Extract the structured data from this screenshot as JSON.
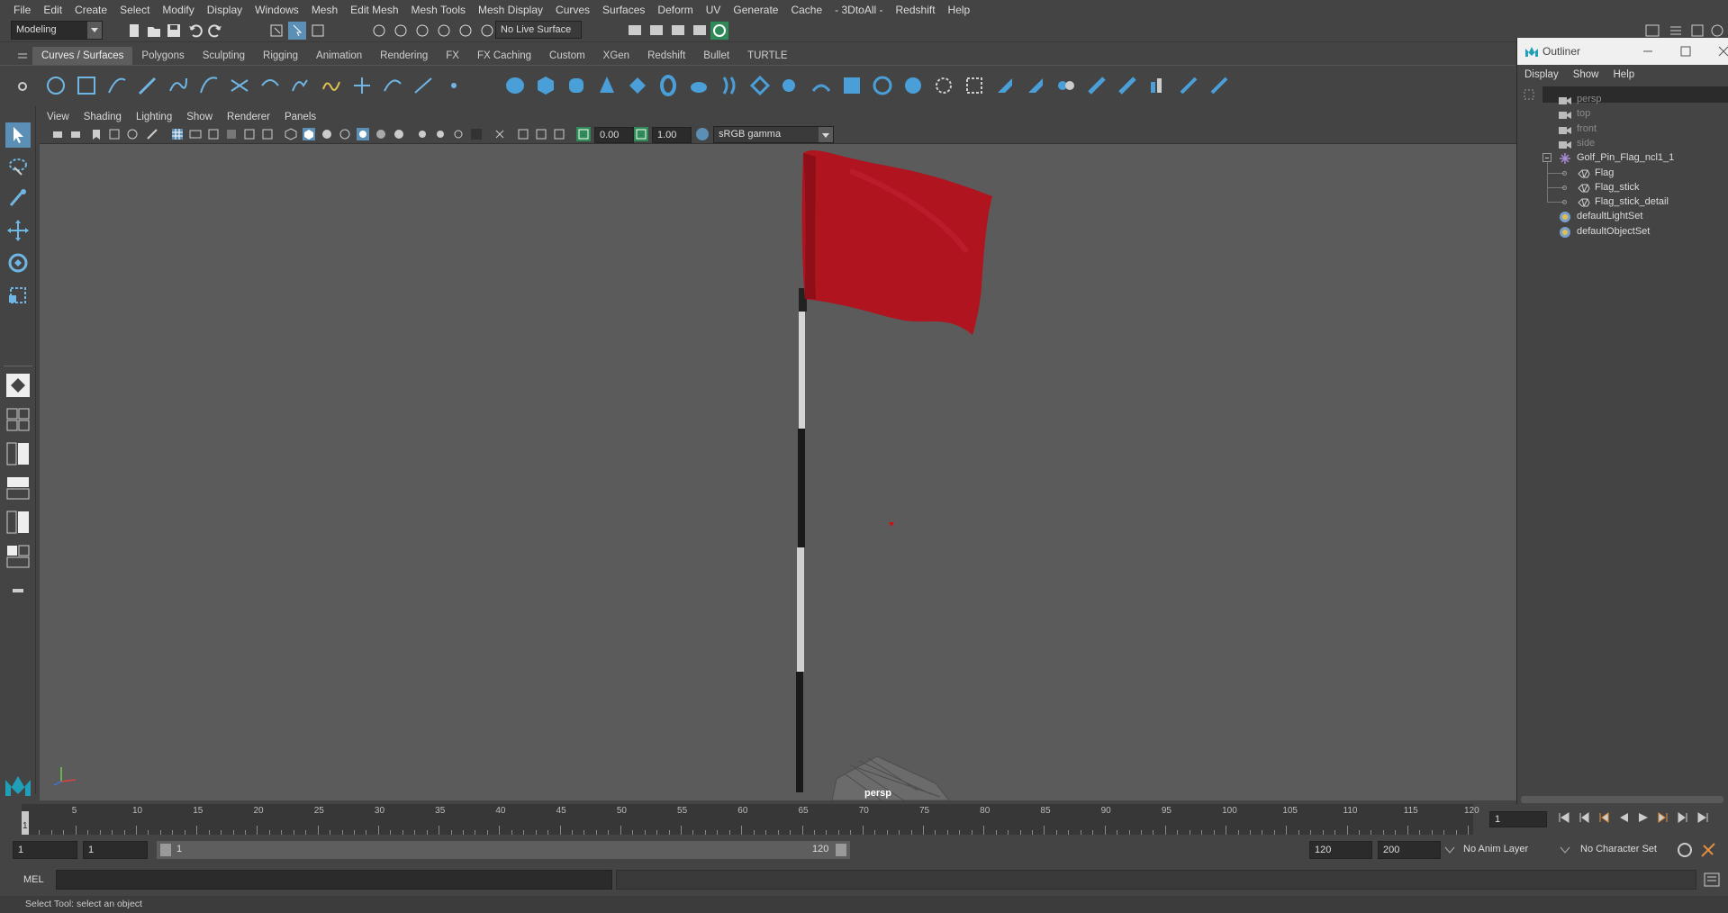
{
  "menu": [
    "File",
    "Edit",
    "Create",
    "Select",
    "Modify",
    "Display",
    "Windows",
    "Mesh",
    "Edit Mesh",
    "Mesh Tools",
    "Mesh Display",
    "Curves",
    "Surfaces",
    "Deform",
    "UV",
    "Generate",
    "Cache",
    "- 3DtoAll -",
    "Redshift",
    "Help"
  ],
  "status": {
    "mode": "Modeling",
    "live_surface": "No Live Surface"
  },
  "shelf_tabs": [
    "Curves / Surfaces",
    "Polygons",
    "Sculpting",
    "Rigging",
    "Animation",
    "Rendering",
    "FX",
    "FX Caching",
    "Custom",
    "XGen",
    "Redshift",
    "Bullet",
    "TURTLE"
  ],
  "viewport_menu": [
    "View",
    "Shading",
    "Lighting",
    "Show",
    "Renderer",
    "Panels"
  ],
  "panel_toolbar": {
    "exposure": "0.00",
    "gamma": "1.00",
    "colorspace": "sRGB gamma"
  },
  "viewport": {
    "camera_label": "persp",
    "flag_color": "#b0141f",
    "background": "#5b5b5b"
  },
  "outliner": {
    "title": "Outliner",
    "menu": [
      "Display",
      "Show",
      "Help"
    ],
    "cameras": [
      "persp",
      "top",
      "front",
      "side"
    ],
    "group": "Golf_Pin_Flag_ncl1_1",
    "children": [
      "Flag",
      "Flag_stick",
      "Flag_stick_detail"
    ],
    "sets": [
      "defaultLightSet",
      "defaultObjectSet"
    ]
  },
  "timeline": {
    "tick_labels": [
      "5",
      "10",
      "15",
      "20",
      "25",
      "30",
      "35",
      "40",
      "45",
      "50",
      "55",
      "60",
      "65",
      "70",
      "75",
      "80",
      "85",
      "90",
      "95",
      "100",
      "105",
      "110",
      "115",
      "120"
    ],
    "current_frame_marker": "1",
    "current_frame": "1"
  },
  "range": {
    "start": "1",
    "playback_start": "1",
    "slider_start": "1",
    "slider_end": "120",
    "playback_end": "120",
    "end": "200",
    "anim_layer": "No Anim Layer",
    "character_set": "No Character Set"
  },
  "cmdline": {
    "label": "MEL"
  },
  "helpline": {
    "text": "Select Tool: select an object"
  }
}
